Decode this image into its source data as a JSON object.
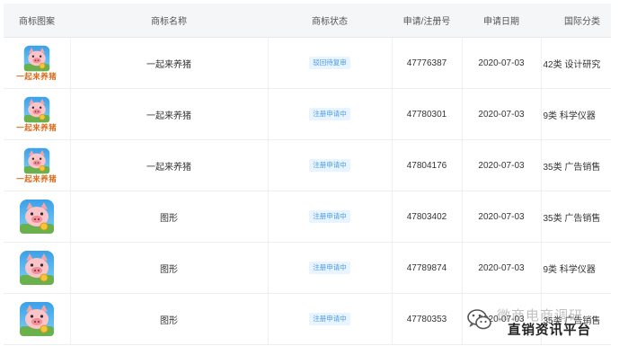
{
  "table": {
    "headers": [
      "商标图案",
      "商标名称",
      "商标状态",
      "申请/注册号",
      "申请日期",
      "国际分类"
    ],
    "rows": [
      {
        "logo_text": "一起来养猪",
        "name": "一起来养猪",
        "status": "驳回待复审",
        "reg_no": "47776387",
        "date": "2020-07-03",
        "category": "42类 设计研究"
      },
      {
        "logo_text": "一起来养猪",
        "name": "一起来养猪",
        "status": "注册申请中",
        "reg_no": "47780301",
        "date": "2020-07-03",
        "category": "9类 科学仪器"
      },
      {
        "logo_text": "一起来养猪",
        "name": "一起来养猪",
        "status": "注册申请中",
        "reg_no": "47804176",
        "date": "2020-07-03",
        "category": "35类 广告销售"
      },
      {
        "logo_text": "",
        "name": "图形",
        "status": "注册申请中",
        "reg_no": "47803402",
        "date": "2020-07-03",
        "category": "35类 广告销售"
      },
      {
        "logo_text": "",
        "name": "图形",
        "status": "注册申请中",
        "reg_no": "47789874",
        "date": "2020-07-03",
        "category": "9类 科学仪器"
      },
      {
        "logo_text": "",
        "name": "图形",
        "status": "注册申请中",
        "reg_no": "47780353",
        "date": "2020-07-03",
        "category": "35类 广告销售"
      }
    ]
  },
  "watermark": {
    "line1": "微商电商调研",
    "line2": "直销资讯平台",
    "icon": "wechat-icon"
  },
  "colors": {
    "badge_bg": "#e8f4ff",
    "badge_text": "#4a9ae0",
    "logo_text": "#d96c1c",
    "header_bg": "#f5f6f7"
  }
}
